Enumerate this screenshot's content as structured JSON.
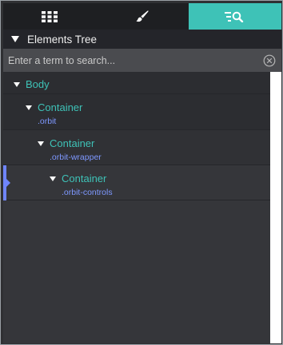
{
  "tabs": [
    {
      "icon": "grid-icon",
      "active": false
    },
    {
      "icon": "brush-icon",
      "active": false
    },
    {
      "icon": "tree-search-icon",
      "active": true
    }
  ],
  "tree_header": {
    "title": "Elements Tree"
  },
  "search": {
    "placeholder": "Enter a term to search...",
    "value": ""
  },
  "tree": {
    "nodes": [
      {
        "label": "Body",
        "class_name": ""
      },
      {
        "label": "Container",
        "class_name": ".orbit"
      },
      {
        "label": "Container",
        "class_name": ".orbit-wrapper"
      },
      {
        "label": "Container",
        "class_name": ".orbit-controls",
        "selected": true
      }
    ]
  },
  "colors": {
    "accent": "#3ec2b7",
    "class_text": "#7e98ff",
    "selection": "#6f85ff"
  }
}
